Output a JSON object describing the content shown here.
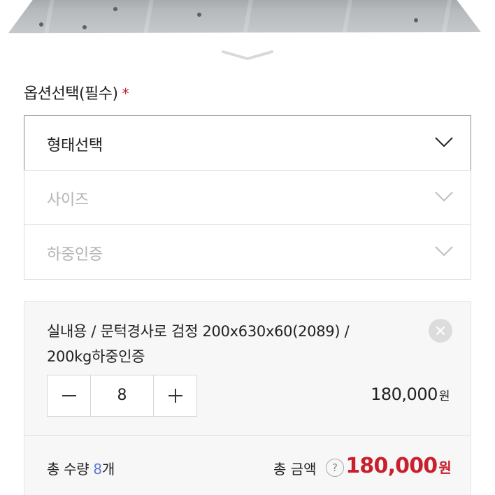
{
  "options": {
    "title": "옵션선택(필수)",
    "required_mark": "*",
    "selects": [
      {
        "label": "형태선택",
        "state": "active"
      },
      {
        "label": "사이즈",
        "state": "disabled"
      },
      {
        "label": "하중인증",
        "state": "disabled"
      }
    ]
  },
  "selected_item": {
    "name_line1": "실내용 / 문턱경사로 검정 200x630x60(2089) /",
    "name_line2": "200kg하중인증",
    "quantity": "8",
    "price": "180,000",
    "currency": "원"
  },
  "totals": {
    "qty_label": "총 수량",
    "qty_value": "8",
    "qty_unit": "개",
    "amount_label": "총 금액",
    "help": "?",
    "amount": "180,000",
    "currency": "원"
  },
  "colors": {
    "accent_red": "#c8202c",
    "qty_blue": "#5b7bd6"
  }
}
